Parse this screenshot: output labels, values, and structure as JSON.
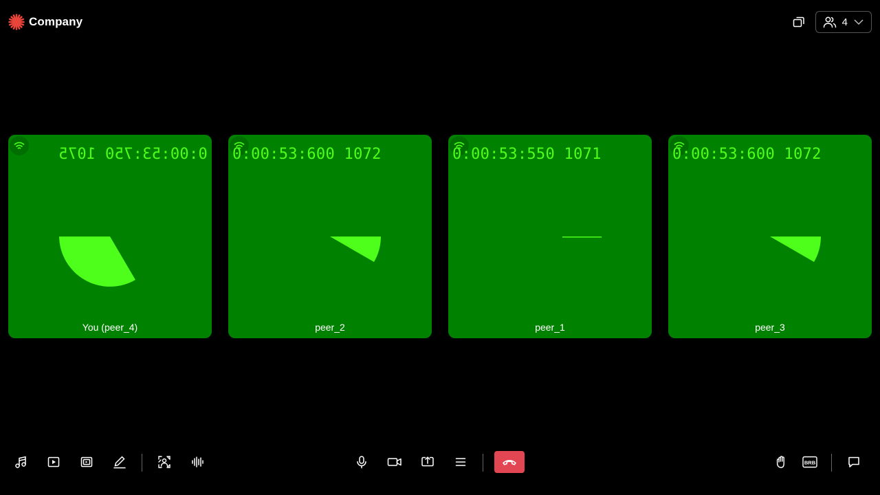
{
  "header": {
    "brand": "Company",
    "participant_count": "4"
  },
  "colors": {
    "tile_bg": "#008200",
    "overlay_green": "#4dff1a",
    "hangup_red": "#e14652",
    "logo_red": "#e8443a"
  },
  "tiles": [
    {
      "name": "You (peer_4)",
      "timestamp": "0:00:53:750 1075",
      "mirrored": true
    },
    {
      "name": "peer_2",
      "timestamp": "0:00:53:600 1072",
      "mirrored": false
    },
    {
      "name": "peer_1",
      "timestamp": "0:00:53:550 1071",
      "mirrored": false
    },
    {
      "name": "peer_3",
      "timestamp": "0:00:53:600 1072",
      "mirrored": false
    }
  ],
  "toolbar": {
    "left": [
      "music-icon",
      "play-video-icon",
      "media-gallery-icon",
      "pencil-icon",
      "virtual-background-icon",
      "audio-waveform-icon"
    ],
    "center": [
      "microphone-icon",
      "camera-icon",
      "share-screen-icon",
      "menu-icon",
      "hang-up-icon"
    ],
    "right": [
      "raise-hand-icon",
      "brb-icon",
      "chat-icon"
    ],
    "brb_label": "BRB"
  }
}
